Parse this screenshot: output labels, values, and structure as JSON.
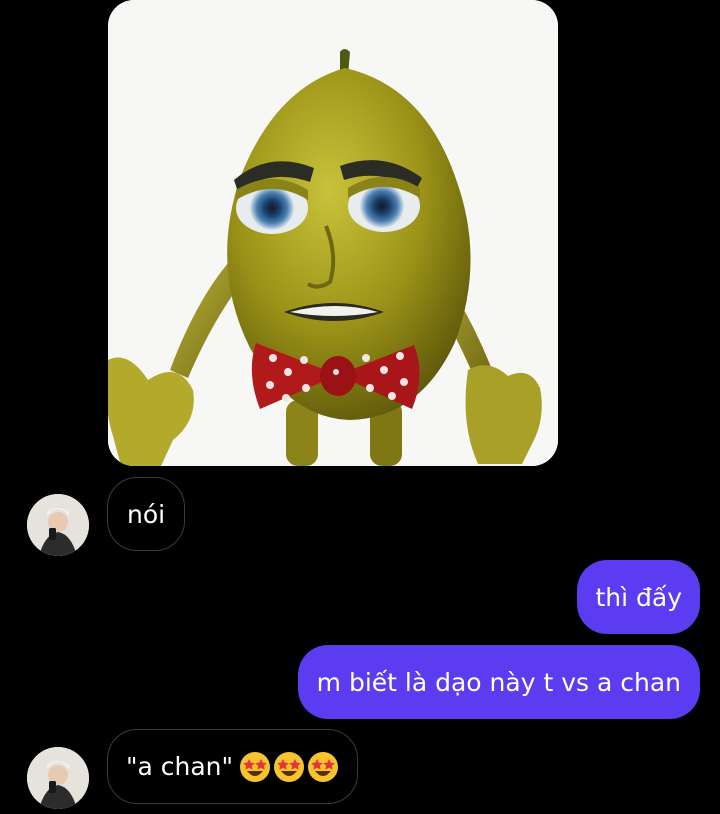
{
  "thread": {
    "messages": [
      {
        "id": "img",
        "direction": "incoming",
        "type": "image",
        "image_subject": "lemon-character-meme"
      },
      {
        "id": "m1",
        "direction": "incoming",
        "type": "text",
        "text": "nói",
        "avatar": "contact-avatar"
      },
      {
        "id": "m2",
        "direction": "outgoing",
        "type": "text",
        "text": "thì đấy"
      },
      {
        "id": "m3",
        "direction": "outgoing",
        "type": "text",
        "text": "m biết là dạo này t vs a chan"
      },
      {
        "id": "m4",
        "direction": "incoming",
        "type": "text",
        "text": "\"a chan\"",
        "emojis": [
          "star-struck",
          "star-struck",
          "star-struck"
        ],
        "avatar": "contact-avatar"
      }
    ]
  },
  "colors": {
    "background": "#000000",
    "outgoing_bubble": "#5b3cf0",
    "incoming_border": "#3a3a3a",
    "text": "#ffffff"
  }
}
